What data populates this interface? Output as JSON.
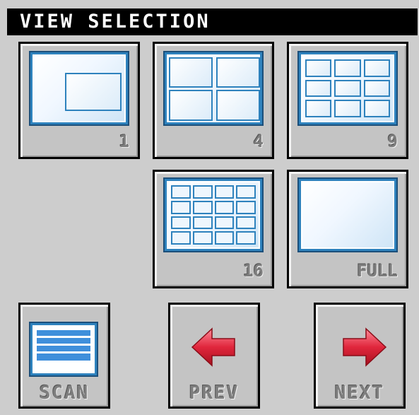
{
  "header": {
    "title": "VIEW SELECTION"
  },
  "views": [
    {
      "label": "1"
    },
    {
      "label": "4"
    },
    {
      "label": "9"
    },
    {
      "label": "16"
    },
    {
      "label": "FULL"
    }
  ],
  "buttons": {
    "scan": "SCAN",
    "prev": "PREV",
    "next": "NEXT"
  },
  "colors": {
    "background": "#cdcdcd",
    "header_bg": "#000000",
    "screen_blue": "#2e82bd",
    "arrow_red": "#d9253b",
    "label_gray": "#7e7e7e"
  },
  "icons": {
    "view_1": "single-view-icon",
    "view_4": "quad-view-icon",
    "view_9": "nine-view-icon",
    "view_16": "sixteen-view-icon",
    "view_full": "full-view-icon",
    "scan": "scan-icon",
    "prev": "left-arrow-icon",
    "next": "right-arrow-icon"
  }
}
